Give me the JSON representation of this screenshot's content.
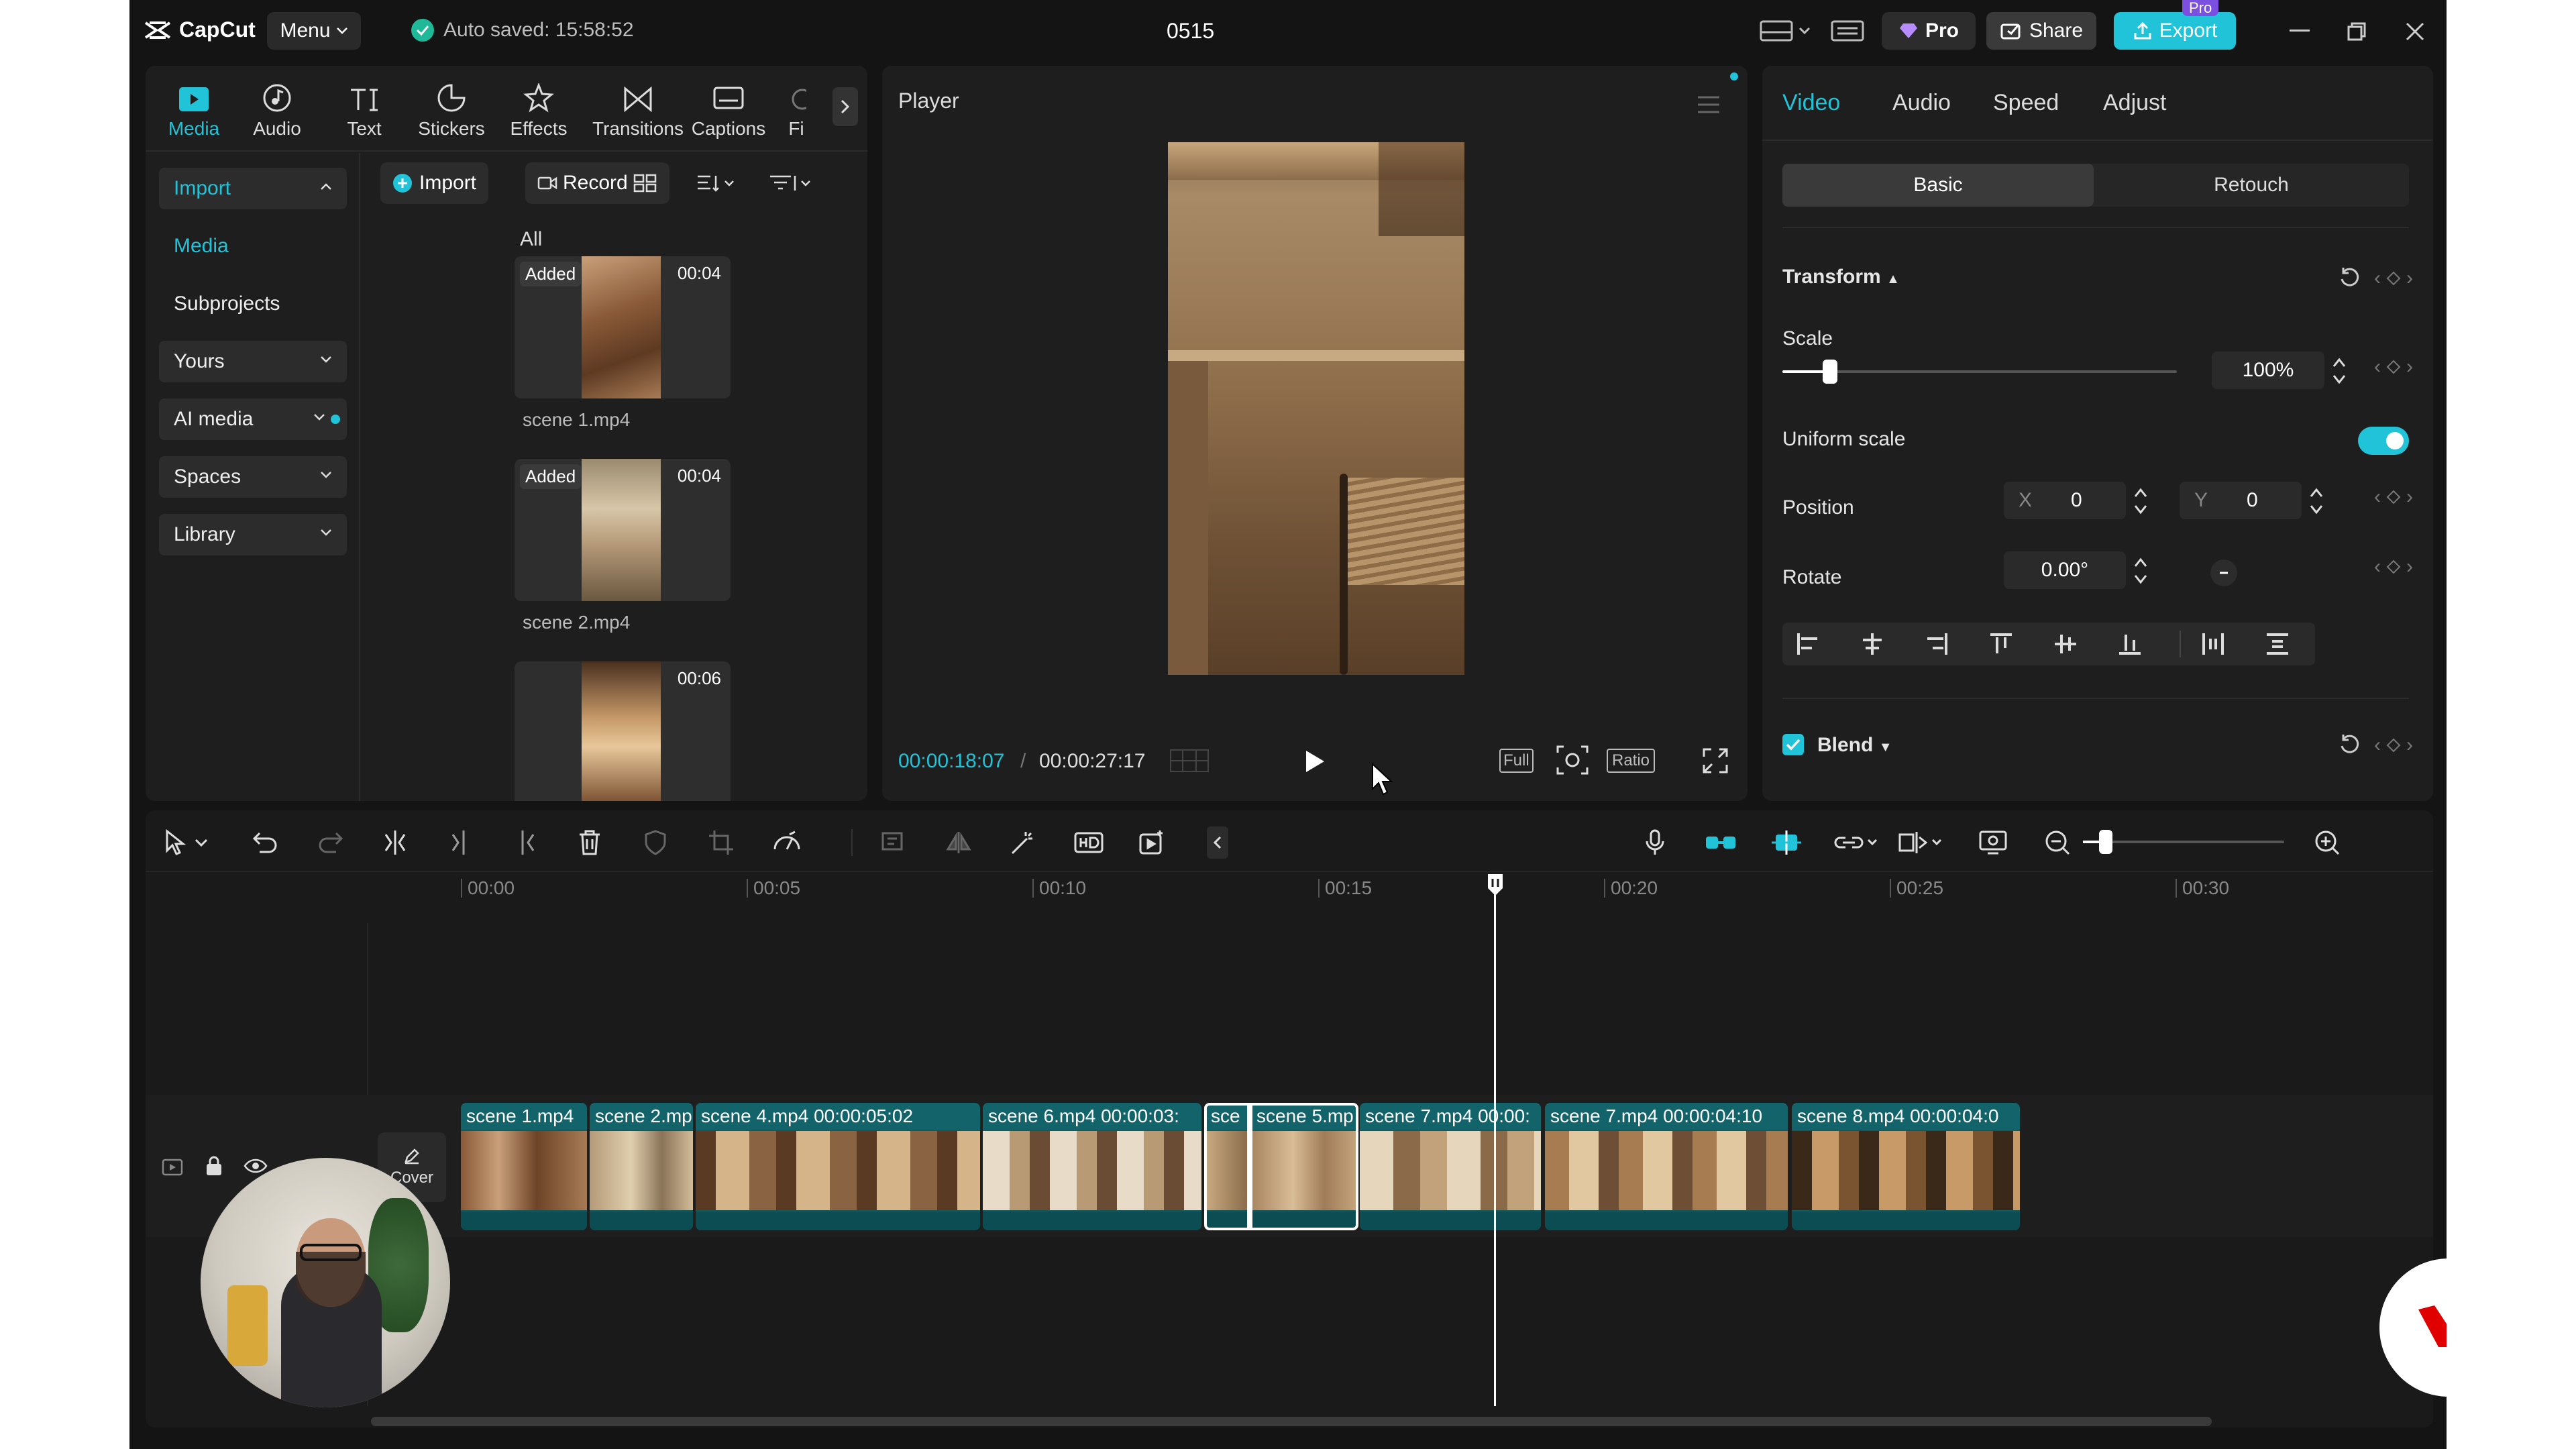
{
  "topbar": {
    "logo": "CapCut",
    "menu": "Menu",
    "autosave": "Auto saved: 15:58:52",
    "project_title": "0515",
    "pro": "Pro",
    "share": "Share",
    "export": "Export",
    "export_badge": "Pro"
  },
  "media_toolbar": [
    "Media",
    "Audio",
    "Text",
    "Stickers",
    "Effects",
    "Transitions",
    "Captions",
    "Fi"
  ],
  "sidebar": {
    "import": "Import",
    "media": "Media",
    "subprojects": "Subprojects",
    "yours": "Yours",
    "ai_media": "AI media",
    "spaces": "Spaces",
    "library": "Library"
  },
  "library": {
    "import_btn": "Import",
    "record_btn": "Record",
    "section": "All",
    "items": [
      {
        "name": "scene 1.mp4",
        "duration": "00:04",
        "badge": "Added"
      },
      {
        "name": "scene 2.mp4",
        "duration": "00:04",
        "badge": "Added"
      },
      {
        "name": "",
        "duration": "00:06",
        "badge": ""
      }
    ]
  },
  "player": {
    "title": "Player",
    "current_time": "00:00:18:07",
    "separator": "/",
    "total_time": "00:00:27:17",
    "full_label": "Full",
    "ratio_label": "Ratio"
  },
  "inspector": {
    "tabs": [
      "Video",
      "Audio",
      "Speed",
      "Adjust"
    ],
    "subtabs": [
      "Basic",
      "Retouch"
    ],
    "transform": "Transform",
    "scale_label": "Scale",
    "scale_value": "100%",
    "scale_fraction": 0.12,
    "uniform_scale": "Uniform scale",
    "uniform_on": true,
    "position_label": "Position",
    "x_label": "X",
    "x_value": "0",
    "y_label": "Y",
    "y_value": "0",
    "rotate_label": "Rotate",
    "rotate_value": "0.00°",
    "blend": "Blend"
  },
  "timeline": {
    "ruler": [
      "00:00",
      "00:05",
      "00:10",
      "00:15",
      "00:20",
      "00:25",
      "00:30"
    ],
    "cover": "Cover",
    "clips": [
      {
        "label": "scene 1.mp4"
      },
      {
        "label": "scene 2.mp"
      },
      {
        "label": "scene 4.mp4  00:00:05:02"
      },
      {
        "label": "scene 6.mp4  00:00:03:"
      },
      {
        "label": "sce"
      },
      {
        "label": "scene 5.mp"
      },
      {
        "label": "scene 7.mp4  00:00:"
      },
      {
        "label": "scene 7.mp4  00:00:04:10"
      },
      {
        "label": "scene 8.mp4  00:00:04:0"
      }
    ]
  },
  "colors": {
    "accent": "#20c3d8",
    "panel": "#1e1e1e",
    "clip": "#0f5b63"
  }
}
